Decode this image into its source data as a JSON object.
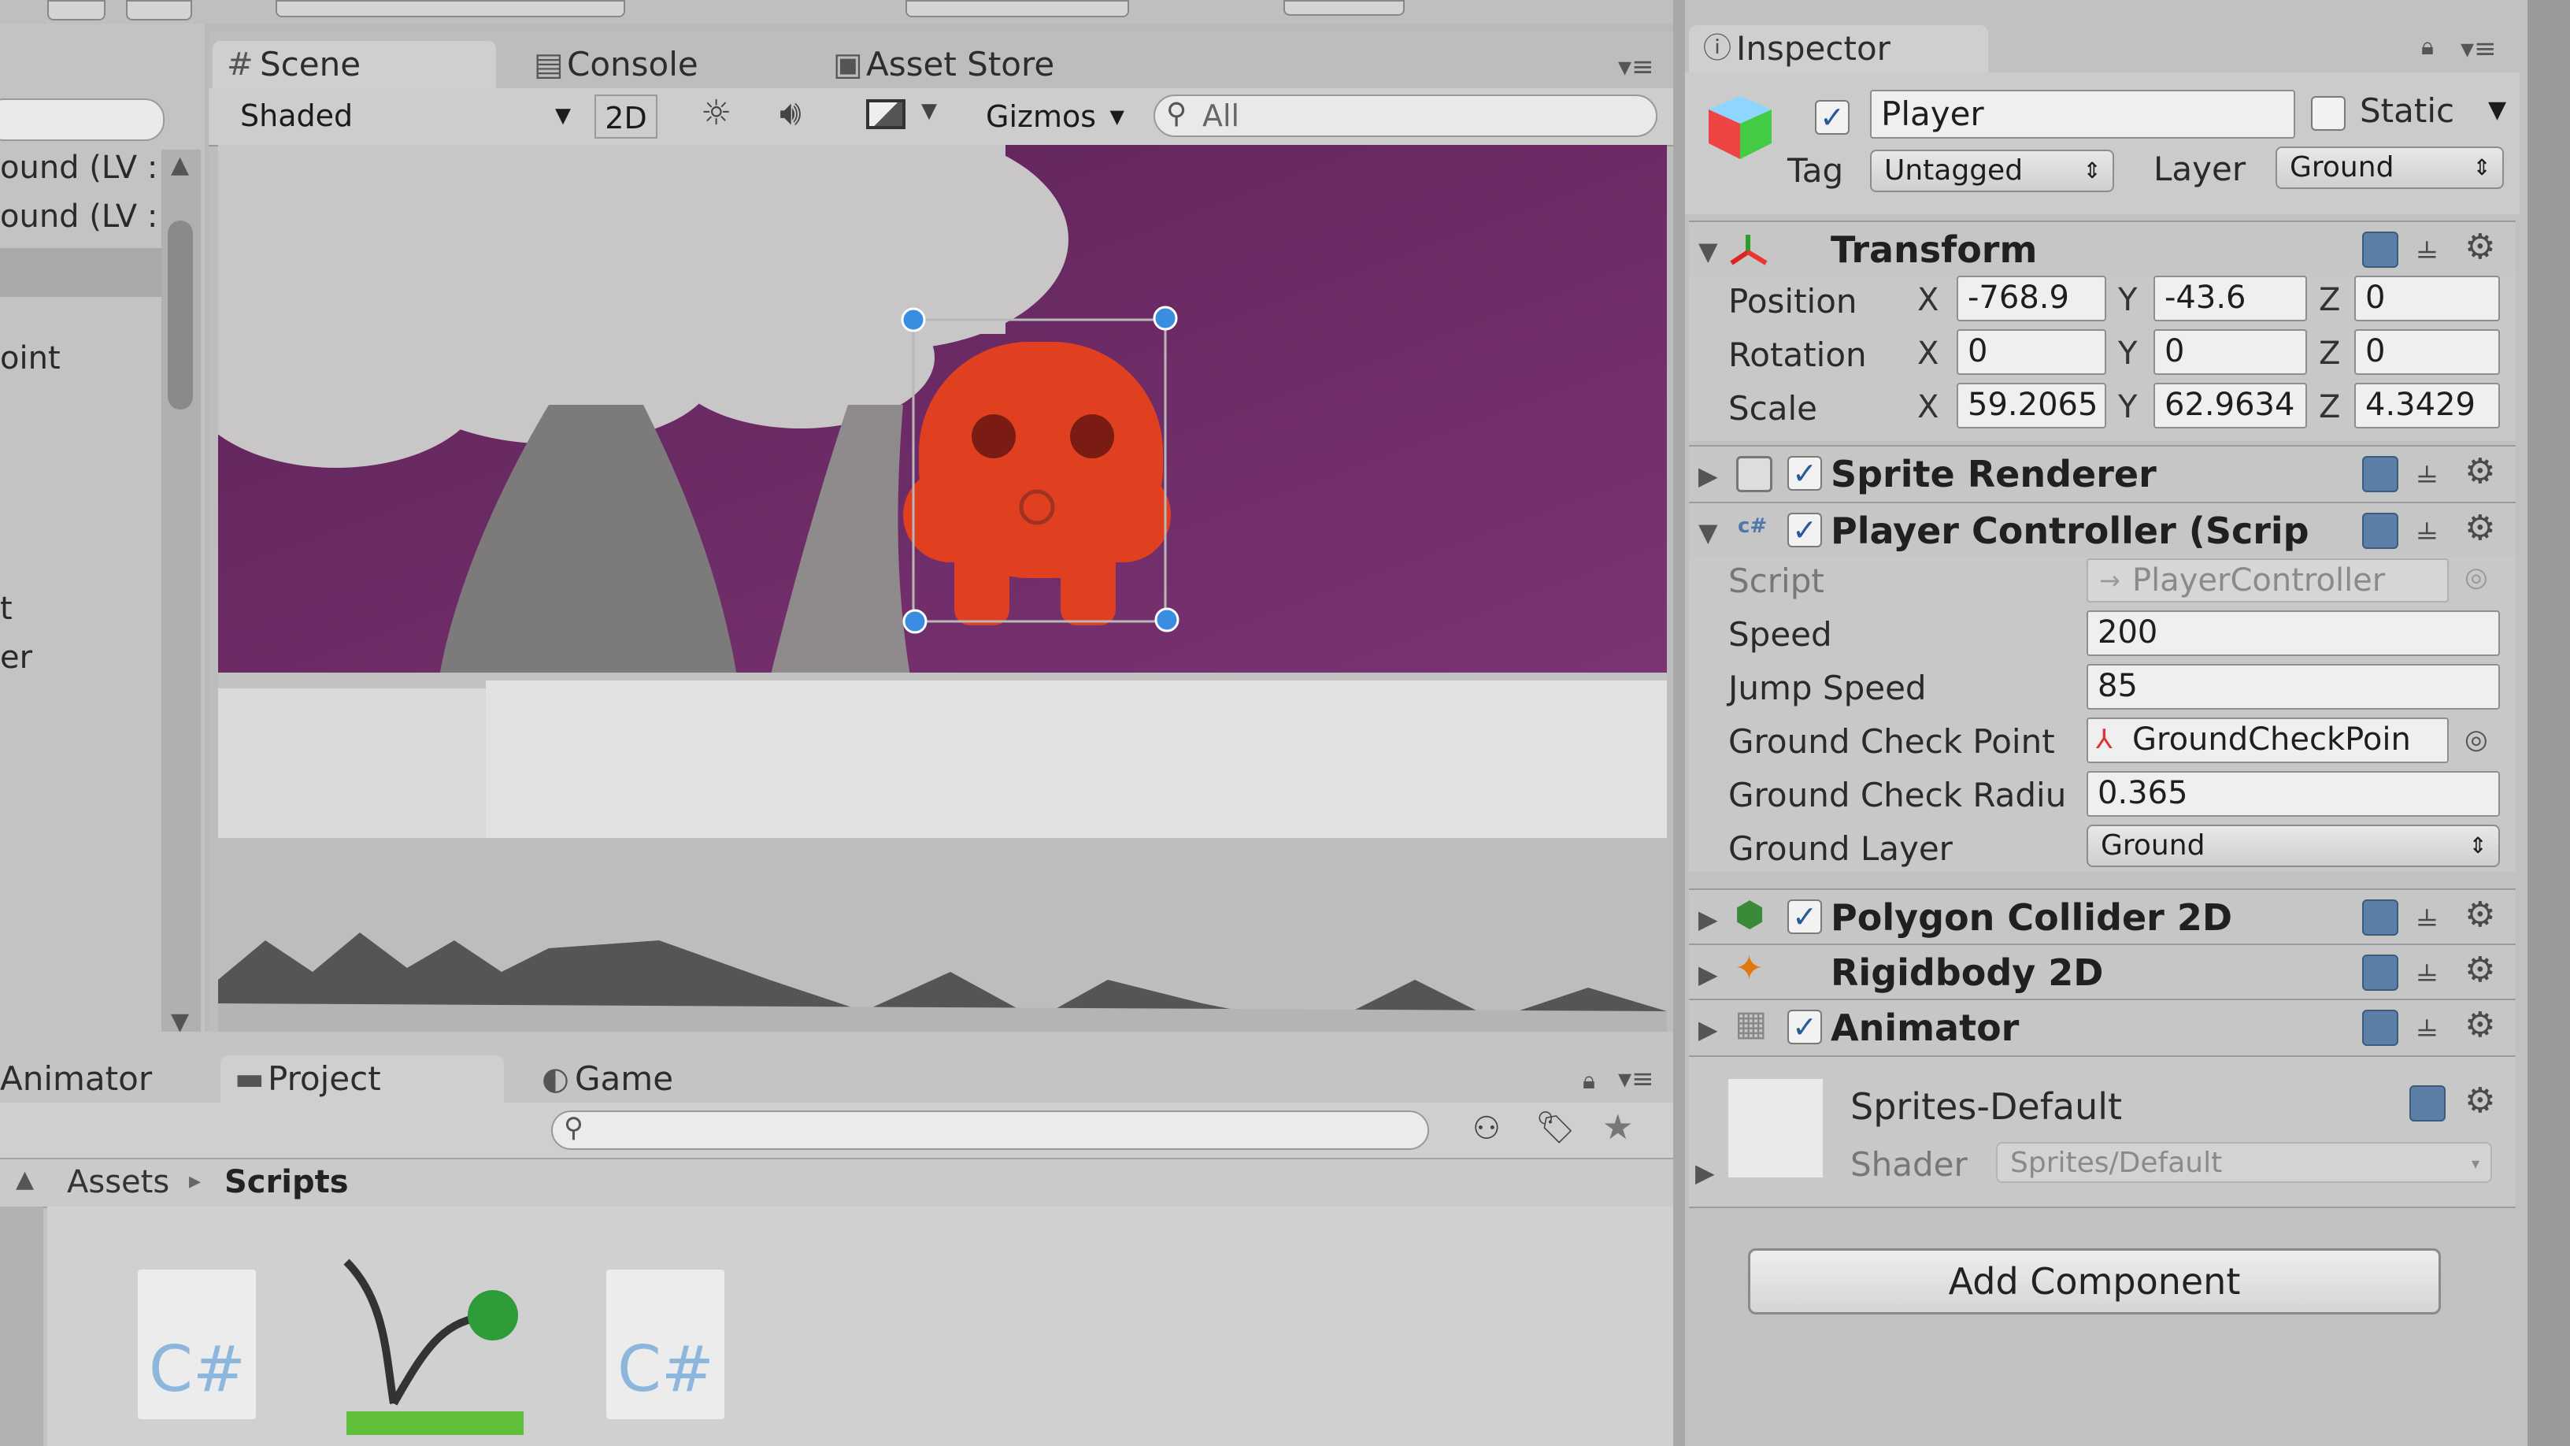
{
  "scene_panel": {
    "tabs": [
      {
        "label": "Scene",
        "icon": "grid-icon"
      },
      {
        "label": "Console",
        "icon": "console-icon"
      },
      {
        "label": "Asset Store",
        "icon": "store-icon"
      }
    ],
    "toolbar": {
      "shading_mode": "Shaded",
      "mode_2d": "2D",
      "gizmos": "Gizmos",
      "search_placeholder": "All"
    }
  },
  "hierarchy": {
    "items": [
      "ound (LV :",
      "ound (LV :",
      "oint",
      "t",
      "er"
    ]
  },
  "bottom_panel": {
    "tabs": [
      {
        "label": "Animator"
      },
      {
        "label": "Project",
        "icon": "folder-icon"
      },
      {
        "label": "Game",
        "icon": "game-icon"
      }
    ],
    "breadcrumb": {
      "root": "Assets",
      "separator": "▸",
      "current": "Scripts"
    },
    "assets": [
      {
        "type": "csharp",
        "label": "C#"
      },
      {
        "type": "animator",
        "label": ""
      },
      {
        "type": "csharp",
        "label": "C#"
      }
    ]
  },
  "inspector": {
    "tab_label": "Inspector",
    "object_name": "Player",
    "static_label": "Static",
    "tag_label": "Tag",
    "tag_value": "Untagged",
    "layer_label": "Layer",
    "layer_value": "Ground",
    "transform": {
      "title": "Transform",
      "position_label": "Position",
      "rotation_label": "Rotation",
      "scale_label": "Scale",
      "position": {
        "x": "-768.9",
        "y": "-43.6",
        "z": "0"
      },
      "rotation": {
        "x": "0",
        "y": "0",
        "z": "0"
      },
      "scale": {
        "x": "59.2065",
        "y": "62.9634",
        "z": "4.3429"
      }
    },
    "sprite_renderer": {
      "title": "Sprite Renderer"
    },
    "player_controller": {
      "title": "Player Controller (Scrip",
      "script_label": "Script",
      "script_value": "PlayerController",
      "speed_label": "Speed",
      "speed_value": "200",
      "jump_label": "Jump Speed",
      "jump_value": "85",
      "gcp_label": "Ground Check Point",
      "gcp_value": "GroundCheckPoin",
      "gcr_label": "Ground Check Radiu",
      "gcr_value": "0.365",
      "gl_label": "Ground Layer",
      "gl_value": "Ground"
    },
    "polygon_collider": {
      "title": "Polygon Collider 2D"
    },
    "rigidbody": {
      "title": "Rigidbody 2D"
    },
    "animator": {
      "title": "Animator"
    },
    "material": {
      "name": "Sprites-Default",
      "shader_label": "Shader",
      "shader_value": "Sprites/Default"
    },
    "add_component": "Add Component"
  },
  "colors": {
    "scene_sky": "#6c2a63",
    "scene_ground": "#dcdcdc",
    "player": "#e0401f",
    "selection_handle": "#3a8de0",
    "accent_blue": "#5b7fa6"
  }
}
